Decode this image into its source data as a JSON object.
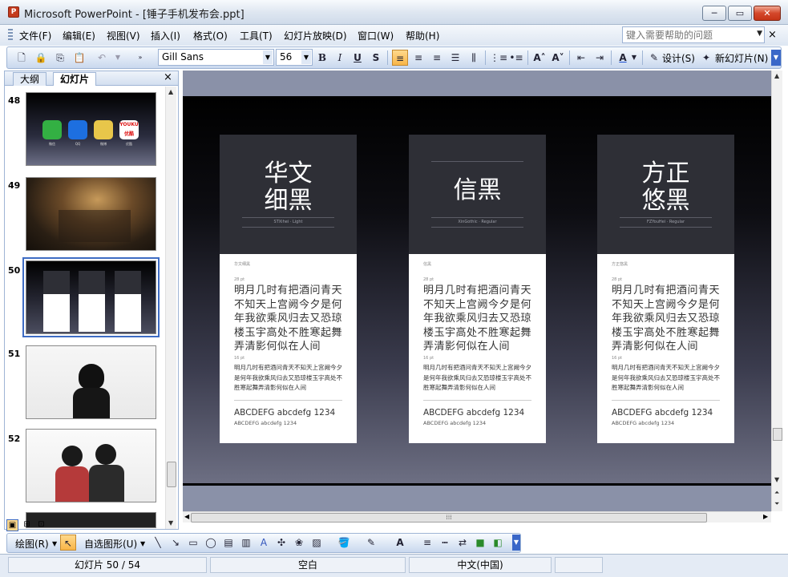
{
  "window": {
    "app_icon": "P",
    "title": "Microsoft PowerPoint - [锤子手机发布会.ppt]",
    "minimize": "─",
    "restore": "▭",
    "close": "✕"
  },
  "menu": {
    "items": [
      "文件(F)",
      "编辑(E)",
      "视图(V)",
      "插入(I)",
      "格式(O)",
      "工具(T)",
      "幻灯片放映(D)",
      "窗口(W)",
      "帮助(H)"
    ],
    "help_placeholder": "键入需要帮助的问题",
    "close": "×"
  },
  "toolbar": {
    "font": "Gill Sans",
    "size": "56",
    "bold": "B",
    "italic": "I",
    "underline": "U",
    "shadow": "S",
    "design_label": "设计(S)",
    "new_slide_label": "新幻灯片(N)"
  },
  "panel": {
    "tab_outline": "大纲",
    "tab_slides": "幻灯片",
    "close": "×",
    "slides": [
      {
        "num": "48"
      },
      {
        "num": "49"
      },
      {
        "num": "50"
      },
      {
        "num": "51"
      },
      {
        "num": "52"
      }
    ],
    "thumb48_labels": [
      "微信",
      "QQ",
      "微博",
      "优酷"
    ],
    "thumb48_logo": "YOUKU优酷"
  },
  "slide": {
    "cards": [
      {
        "name_line1": "华文",
        "name_line2": "细黑",
        "subname": "STXihei · Light",
        "tag": "华文细黑",
        "size1": "28 pt",
        "poem": "明月几时有把酒问青天不知天上宫阙今夕是何年我欲乘风归去又恐琼楼玉宇高处不胜寒起舞弄清影何似在人间",
        "size2": "16 pt",
        "poem_small": "明月几时有把酒问青天不知天上宫阙今夕是何年我欲乘风归去又恐琼楼玉宇高处不胜寒起舞弄清影何似在人间",
        "latin_large": "ABCDEFG abcdefg 1234",
        "latin_small": "ABCDEFG abcdefg 1234"
      },
      {
        "name_line1": "信黑",
        "name_line2": "",
        "subname": "XinGothic · Regular",
        "tag": "信黑",
        "size1": "28 pt",
        "poem": "明月几时有把酒问青天不知天上宫阙今夕是何年我欲乘风归去又恐琼楼玉宇高处不胜寒起舞弄清影何似在人间",
        "size2": "16 pt",
        "poem_small": "明月几时有把酒问青天不知天上宫阙今夕是何年我欲乘风归去又恐琼楼玉宇高处不胜寒起舞弄清影何似在人间",
        "latin_large": "ABCDEFG abcdefg 1234",
        "latin_small": "ABCDEFG abcdefg 1234"
      },
      {
        "name_line1": "方正",
        "name_line2": "悠黑",
        "subname": "FZYouHei · Regular",
        "tag": "方正悠黑",
        "size1": "28 pt",
        "poem": "明月几时有把酒问青天不知天上宫阙今夕是何年我欲乘风归去又恐琼楼玉宇高处不胜寒起舞弄清影何似在人间",
        "size2": "16 pt",
        "poem_small": "明月几时有把酒问青天不知天上宫阙今夕是何年我欲乘风归去又恐琼楼玉宇高处不胜寒起舞弄清影何似在人间",
        "latin_large": "ABCDEFG abcdefg 1234",
        "latin_small": "ABCDEFG abcdefg 1234"
      }
    ]
  },
  "drawbar": {
    "draw_label": "绘图(R)",
    "autoshape_label": "自选图形(U)"
  },
  "status": {
    "slide_of": "幻灯片 50 / 54",
    "template": "空白",
    "language": "中文(中国)"
  }
}
